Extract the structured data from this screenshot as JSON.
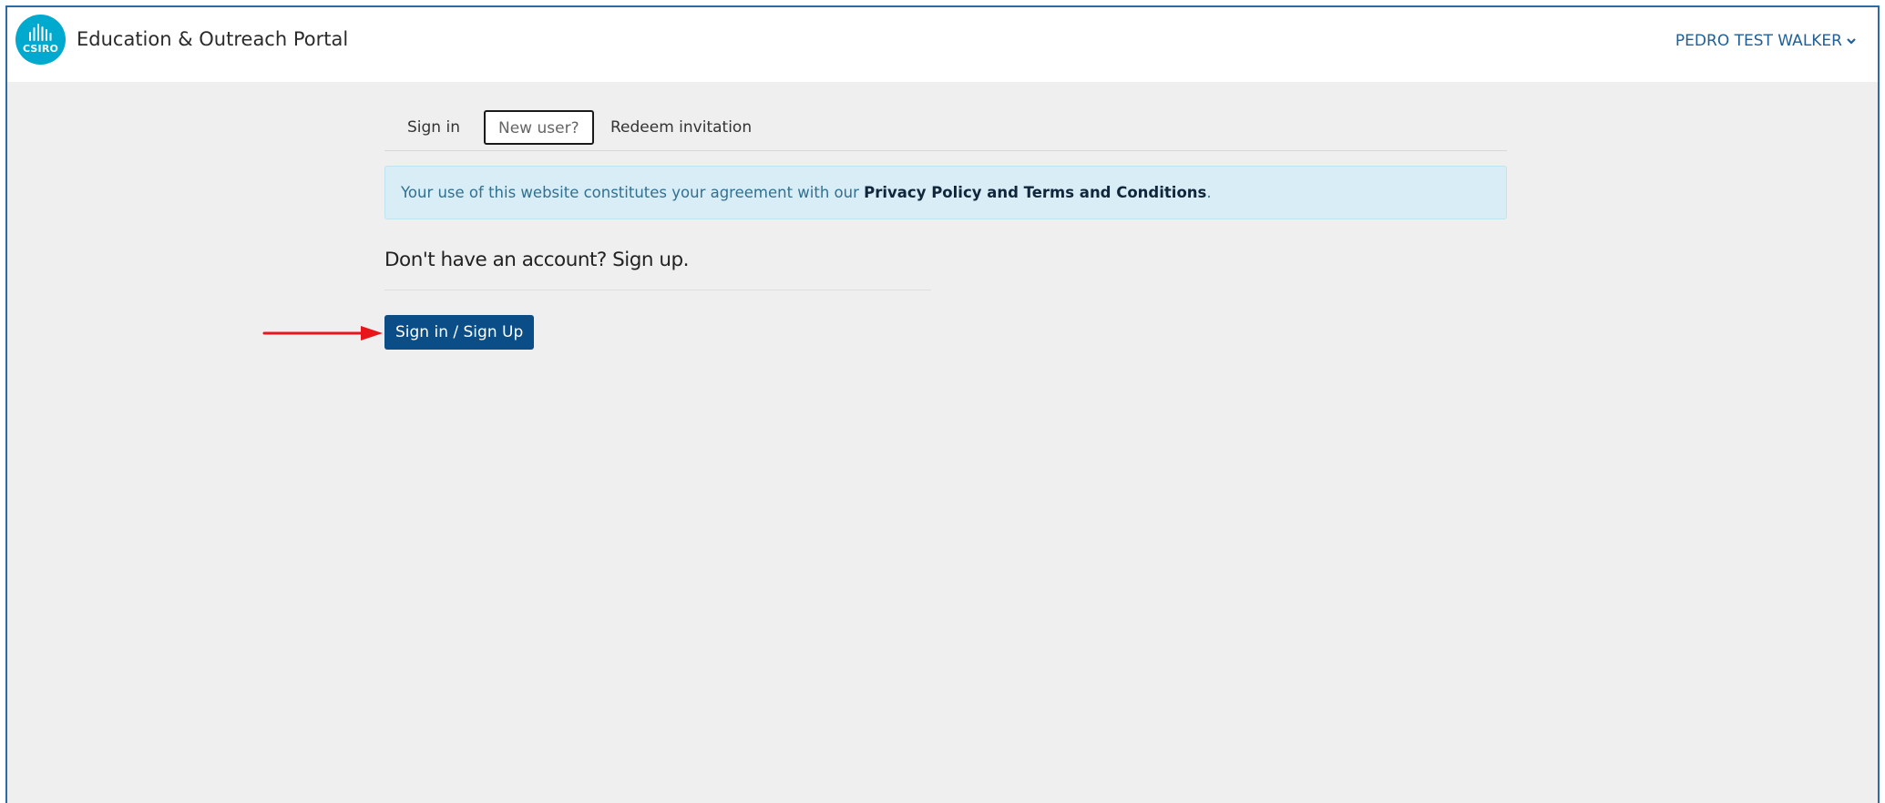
{
  "header": {
    "logo_text": "CSIRO",
    "brand_title": "Education & Outreach Portal",
    "user_name": "PEDRO TEST WALKER"
  },
  "tabs": [
    {
      "label": "Sign in",
      "active": false
    },
    {
      "label": "New user?",
      "active": true
    },
    {
      "label": "Redeem invitation",
      "active": false
    }
  ],
  "alert": {
    "text": "Your use of this website constitutes your agreement with our ",
    "link_text": "Privacy Policy and Terms and Conditions",
    "suffix": "."
  },
  "signup": {
    "heading": "Don't have an account? Sign up.",
    "button_label": "Sign in / Sign Up"
  },
  "colors": {
    "logo": "#00a9ce",
    "primary_button": "#0a4d87",
    "alert_bg": "#d9edf7",
    "annotation_arrow": "#e8161b"
  }
}
